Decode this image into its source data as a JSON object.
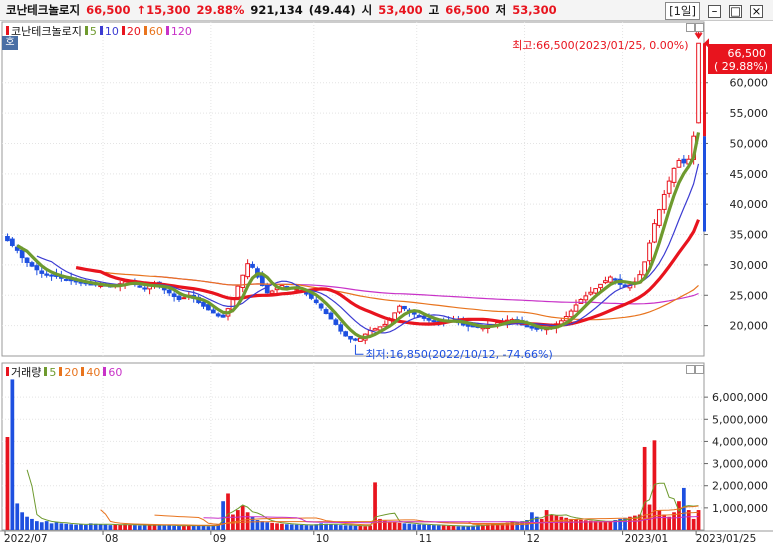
{
  "header": {
    "name": "코난테크놀로지",
    "price": "66,500",
    "change": "↑15,300",
    "change_pct": "29.88%",
    "volume": "921,134",
    "volume_ratio": "(49.44)",
    "open_label": "시",
    "open": "53,400",
    "high_label": "고",
    "high": "66,500",
    "low_label": "저",
    "low": "53,300",
    "period": "[1일]",
    "btn_min": "–",
    "btn_max": "□",
    "btn_close": "×"
  },
  "toggle_label": "호",
  "price_legend": [
    {
      "label": "코난테크놀로지",
      "color": "#e8141e"
    },
    {
      "label": "5",
      "color": "#6e9a2e"
    },
    {
      "label": "10",
      "color": "#3c3cd2"
    },
    {
      "label": "20",
      "color": "#e8141e"
    },
    {
      "label": "60",
      "color": "#e8741e"
    },
    {
      "label": "120",
      "color": "#c832c8"
    }
  ],
  "volume_legend": [
    {
      "label": "거래량",
      "color": "#e8141e"
    },
    {
      "label": "5",
      "color": "#6e9a2e"
    },
    {
      "label": "20",
      "color": "#e8741e"
    },
    {
      "label": "40",
      "color": "#e8741e"
    },
    {
      "label": "60",
      "color": "#c832c8"
    }
  ],
  "annotations": {
    "high": "최고:66,500(2023/01/25, 0.00%)",
    "low": "최저:16,850(2022/10/12, -74.66%)",
    "up_marker": "상",
    "price_box": "66,500",
    "price_box_pct": "( 29.88%)"
  },
  "chart_data": [
    {
      "type": "candlestick",
      "title": "코난테크놀로지",
      "ylim": [
        15000,
        70000
      ],
      "ticks": [
        "20,000",
        "25,000",
        "30,000",
        "35,000",
        "40,000",
        "45,000",
        "50,000",
        "55,000",
        "60,000"
      ],
      "tick_values": [
        20000,
        25000,
        30000,
        35000,
        40000,
        45000,
        50000,
        55000,
        60000
      ],
      "x_labels": [
        "2022/07",
        "08",
        "09",
        "10",
        "11",
        "12",
        "2023/01",
        "2023/01/25"
      ],
      "x_label_index": [
        0,
        20,
        42,
        63,
        84,
        106,
        126,
        141
      ],
      "candle_count": 142,
      "close_series": [
        34000,
        33200,
        32400,
        31200,
        30400,
        29800,
        29200,
        28600,
        28300,
        28200,
        28100,
        27800,
        27600,
        27400,
        27200,
        27100,
        26900,
        26800,
        26700,
        26600,
        26500,
        26400,
        26600,
        26900,
        27200,
        27400,
        26800,
        26400,
        26100,
        26600,
        27000,
        26500,
        25900,
        25400,
        24800,
        24300,
        24600,
        25000,
        24500,
        23800,
        23200,
        22600,
        22100,
        21600,
        21400,
        22800,
        24600,
        26500,
        28300,
        30200,
        29600,
        28000,
        26600,
        25400,
        25700,
        26200,
        26600,
        26300,
        26100,
        26000,
        25700,
        25200,
        24500,
        23800,
        22900,
        22000,
        21100,
        20200,
        19100,
        18300,
        17800,
        17600,
        17900,
        18600,
        19200,
        19500,
        19800,
        20200,
        21000,
        22100,
        23200,
        22800,
        22300,
        21900,
        21500,
        21200,
        20900,
        20700,
        20600,
        20700,
        20800,
        20900,
        20500,
        20100,
        19900,
        19800,
        19700,
        19800,
        20000,
        20200,
        20500,
        20700,
        20900,
        21000,
        20600,
        20100,
        19800,
        19600,
        19400,
        19500,
        19600,
        19900,
        20300,
        20800,
        21500,
        22400,
        23400,
        24300,
        24900,
        25500,
        26100,
        26800,
        27400,
        28000,
        27500,
        26800,
        26400,
        26700,
        27200,
        28400,
        30500,
        33600,
        36800,
        39100,
        41600,
        43800,
        45900,
        47200,
        46800,
        47400,
        51200,
        66500
      ],
      "last": {
        "open": 53400,
        "high": 66500,
        "low": 53300,
        "close": 66500
      }
    },
    {
      "type": "bar",
      "title": "거래량",
      "ylim": [
        0,
        7000000
      ],
      "ticks": [
        "1,000,000",
        "2,000,000",
        "3,000,000",
        "4,000,000",
        "5,000,000",
        "6,000,000"
      ],
      "tick_values": [
        1000000,
        2000000,
        3000000,
        4000000,
        5000000,
        6000000
      ],
      "values": [
        4200000,
        6800000,
        1200000,
        800000,
        600000,
        500000,
        400000,
        350000,
        400000,
        300000,
        350000,
        300000,
        280000,
        260000,
        240000,
        250000,
        230000,
        300000,
        280000,
        260000,
        240000,
        220000,
        250000,
        230000,
        260000,
        240000,
        220000,
        200000,
        210000,
        230000,
        250000,
        220000,
        200000,
        210000,
        190000,
        180000,
        200000,
        220000,
        210000,
        190000,
        180000,
        170000,
        220000,
        260000,
        1300000,
        1650000,
        700000,
        900000,
        1100000,
        800000,
        600000,
        450000,
        400000,
        350000,
        320000,
        300000,
        280000,
        260000,
        250000,
        240000,
        230000,
        220000,
        210000,
        260000,
        300000,
        280000,
        260000,
        240000,
        220000,
        210000,
        200000,
        190000,
        180000,
        170000,
        200000,
        2150000,
        500000,
        420000,
        380000,
        350000,
        320000,
        300000,
        280000,
        260000,
        250000,
        240000,
        230000,
        220000,
        210000,
        200000,
        190000,
        180000,
        170000,
        160000,
        180000,
        200000,
        220000,
        240000,
        260000,
        280000,
        300000,
        320000,
        340000,
        360000,
        380000,
        400000,
        450000,
        800000,
        600000,
        500000,
        900000,
        700000,
        650000,
        600000,
        550000,
        500000,
        480000,
        460000,
        440000,
        420000,
        400000,
        380000,
        360000,
        400000,
        450000,
        500000,
        550000,
        600000,
        650000,
        700000,
        3750000,
        1150000,
        4050000,
        900000,
        700000,
        600000,
        800000,
        1300000,
        1900000,
        900000,
        500000,
        900000
      ]
    }
  ]
}
